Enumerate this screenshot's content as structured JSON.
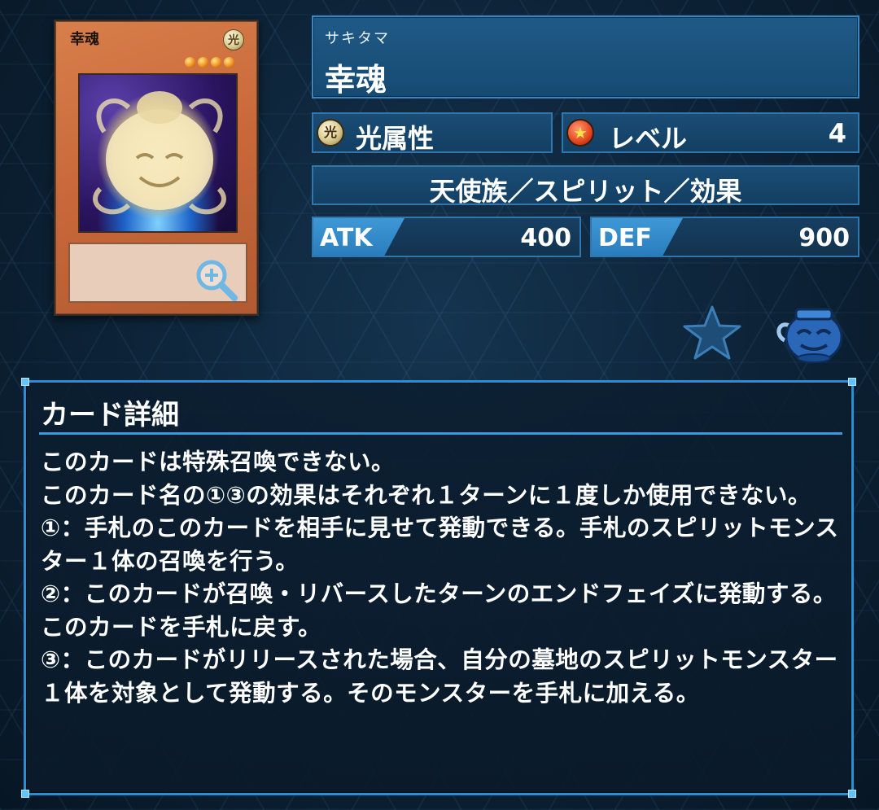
{
  "card": {
    "name_ruby": "サキタマ",
    "name": "幸魂",
    "image": {
      "name_text": "幸魂",
      "attribute_glyph": "光",
      "level_stars": 4
    },
    "attribute": {
      "icon": "light-attribute-icon",
      "label": "光属性"
    },
    "level": {
      "icon": "level-star-icon",
      "label": "レベル",
      "value": "4"
    },
    "type_line": "天使族／スピリット／効果",
    "atk": {
      "label": "ATK",
      "value": "400"
    },
    "def": {
      "label": "DEF",
      "value": "900"
    }
  },
  "actions": {
    "favorite_icon": "star-icon",
    "deck_icon": "pot-of-greed-icon",
    "zoom_icon": "zoom-in-icon"
  },
  "details": {
    "title": "カード詳細",
    "text": "このカードは特殊召喚できない。\nこのカード名の①③の効果はそれぞれ１ターンに１度しか使用できない。\n①：手札のこのカードを相手に見せて発動できる。手札のスピリットモンスター１体の召喚を行う。\n②：このカードが召喚・リバースしたターンのエンドフェイズに発動する。このカードを手札に戻す。\n③：このカードがリリースされた場合、自分の墓地のスピリットモンスター１体を対象として発動する。そのモンスターを手札に加える。"
  },
  "colors": {
    "panel_border": "#2b8ed4",
    "box_fill": "#1a4d75",
    "atkdef_tab": "#3f98d6",
    "card_frame": "#c8683a"
  }
}
